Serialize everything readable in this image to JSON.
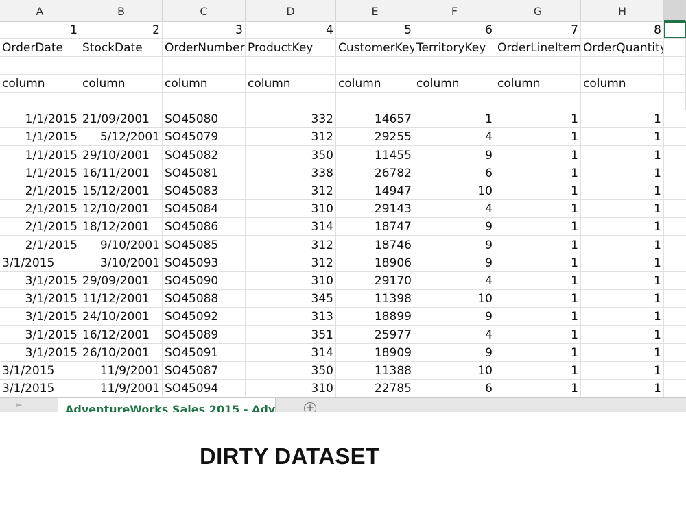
{
  "spreadsheet": {
    "column_letters": [
      "A",
      "B",
      "C",
      "D",
      "E",
      "F",
      "G",
      "H",
      ""
    ],
    "row_numbers": [
      "1",
      "2",
      "3",
      "4",
      "5",
      "6",
      "7",
      "8",
      ""
    ],
    "headers": [
      "OrderDate",
      "StockDate",
      "OrderNumber",
      "ProductKey",
      "CustomerKey",
      "TerritoryKey",
      "OrderLineItem",
      "OrderQuantity",
      ""
    ],
    "type_labels": [
      "column",
      "column",
      "column",
      "column",
      "column",
      "column",
      "column",
      "column",
      ""
    ],
    "data_rows": [
      [
        "1/1/2015",
        "21/09/2001",
        "SO45080",
        "332",
        "14657",
        "1",
        "1",
        "1"
      ],
      [
        "1/1/2015",
        "5/12/2001",
        "SO45079",
        "312",
        "29255",
        "4",
        "1",
        "1"
      ],
      [
        "1/1/2015",
        "29/10/2001",
        "SO45082",
        "350",
        "11455",
        "9",
        "1",
        "1"
      ],
      [
        "1/1/2015",
        "16/11/2001",
        "SO45081",
        "338",
        "26782",
        "6",
        "1",
        "1"
      ],
      [
        "2/1/2015",
        "15/12/2001",
        "SO45083",
        "312",
        "14947",
        "10",
        "1",
        "1"
      ],
      [
        "2/1/2015",
        "12/10/2001",
        "SO45084",
        "310",
        "29143",
        "4",
        "1",
        "1"
      ],
      [
        "2/1/2015",
        "18/12/2001",
        "SO45086",
        "314",
        "18747",
        "9",
        "1",
        "1"
      ],
      [
        "2/1/2015",
        "9/10/2001",
        "SO45085",
        "312",
        "18746",
        "9",
        "1",
        "1"
      ],
      [
        "3/1/2015",
        "3/10/2001",
        "SO45093",
        "312",
        "18906",
        "9",
        "1",
        "1"
      ],
      [
        "3/1/2015",
        "29/09/2001",
        "SO45090",
        "310",
        "29170",
        "4",
        "1",
        "1"
      ],
      [
        "3/1/2015",
        "11/12/2001",
        "SO45088",
        "345",
        "11398",
        "10",
        "1",
        "1"
      ],
      [
        "3/1/2015",
        "24/10/2001",
        "SO45092",
        "313",
        "18899",
        "9",
        "1",
        "1"
      ],
      [
        "3/1/2015",
        "16/12/2001",
        "SO45089",
        "351",
        "25977",
        "4",
        "1",
        "1"
      ],
      [
        "3/1/2015",
        "26/10/2001",
        "SO45091",
        "314",
        "18909",
        "9",
        "1",
        "1"
      ],
      [
        "3/1/2015",
        "11/9/2001",
        "SO45087",
        "350",
        "11388",
        "10",
        "1",
        "1"
      ],
      [
        "3/1/2015",
        "11/9/2001",
        "SO45094",
        "310",
        "22785",
        "6",
        "1",
        "1"
      ]
    ],
    "sheet_tab": "AdventureWorks Sales 2015 - Adv",
    "add_sheet_icon": "+",
    "nav_arrow_icon": "►"
  },
  "caption": "DIRTY DATASET"
}
